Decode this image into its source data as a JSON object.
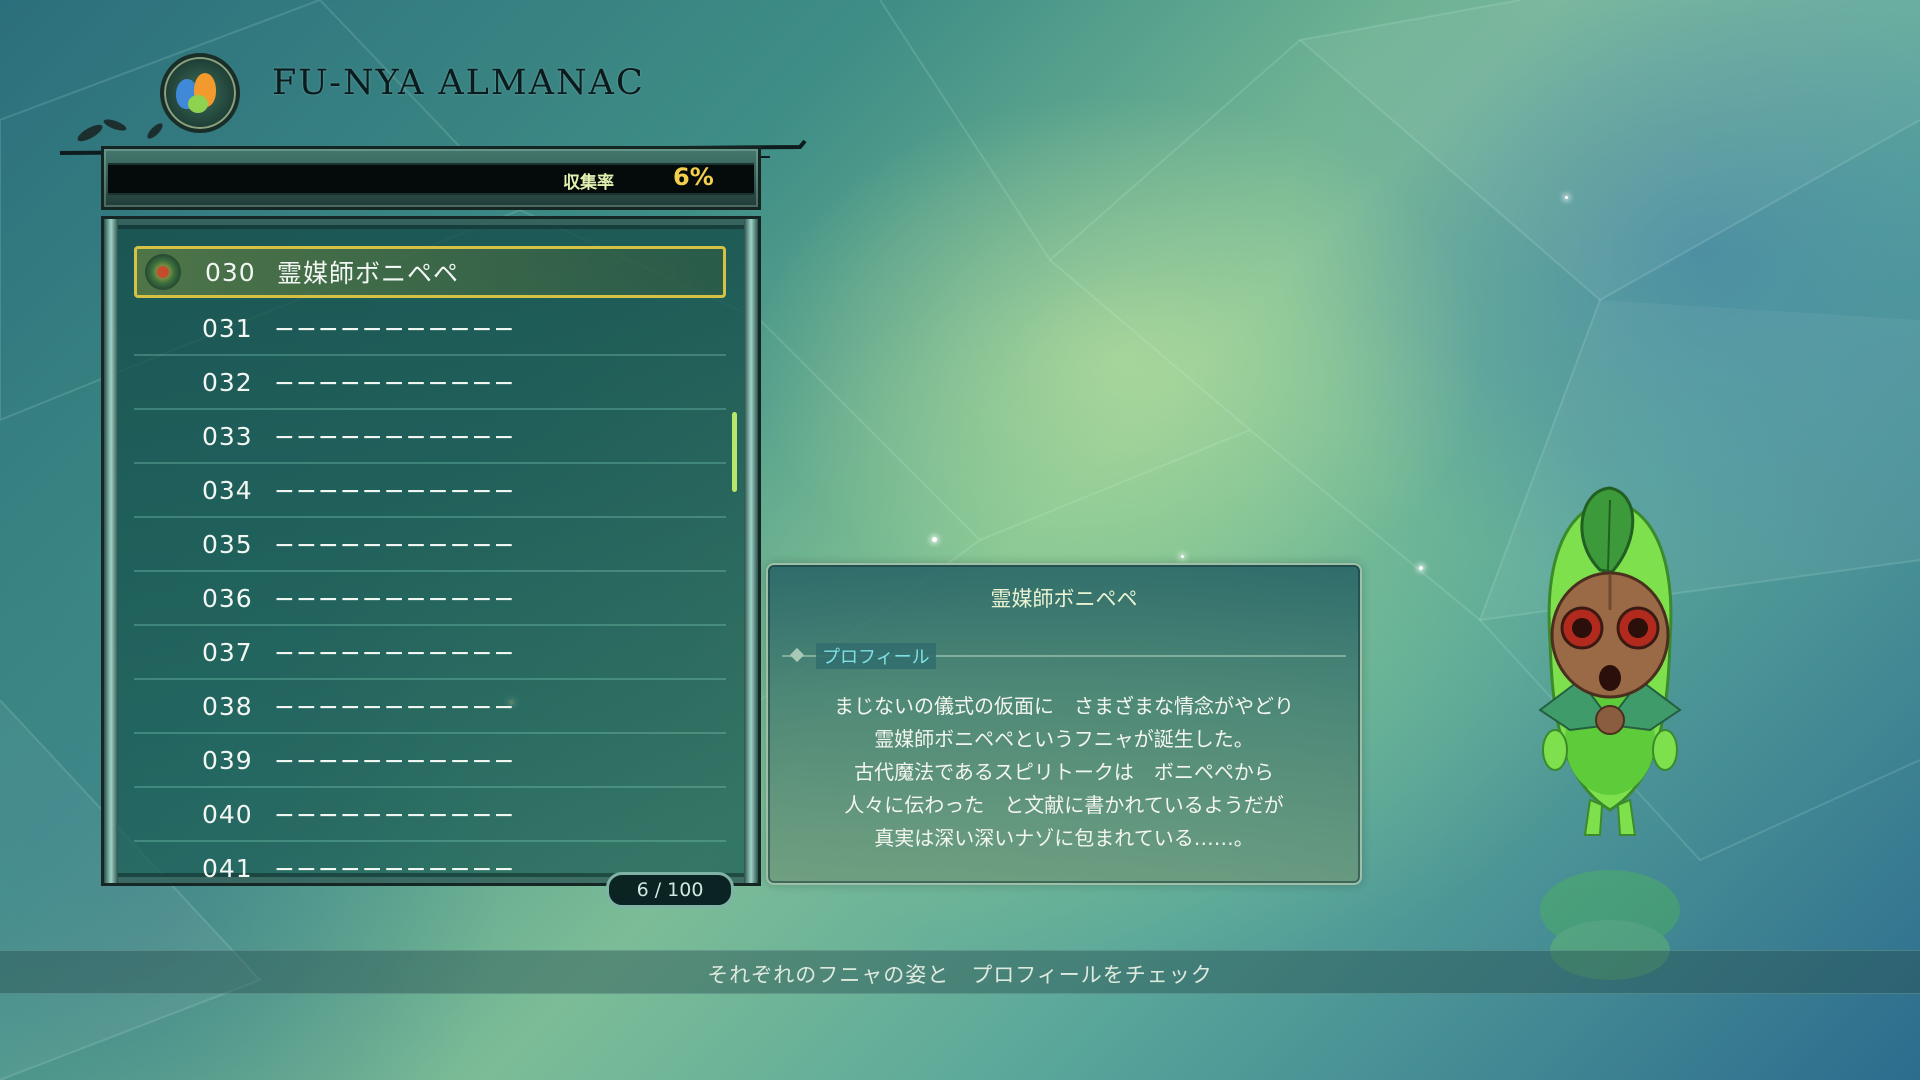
{
  "header": {
    "title": "FU-NYA  ALMANAC"
  },
  "collection_rate": {
    "label": "収集率",
    "value": "6%"
  },
  "almanac_list": {
    "items": [
      {
        "number": "030",
        "name": "霊媒師ボニペペ",
        "selected": true
      },
      {
        "number": "031",
        "name": "−−−−−−−−−−−"
      },
      {
        "number": "032",
        "name": "−−−−−−−−−−−"
      },
      {
        "number": "033",
        "name": "−−−−−−−−−−−"
      },
      {
        "number": "034",
        "name": "−−−−−−−−−−−"
      },
      {
        "number": "035",
        "name": "−−−−−−−−−−−"
      },
      {
        "number": "036",
        "name": "−−−−−−−−−−−"
      },
      {
        "number": "037",
        "name": "−−−−−−−−−−−"
      },
      {
        "number": "038",
        "name": "−−−−−−−−−−−"
      },
      {
        "number": "039",
        "name": "−−−−−−−−−−−"
      },
      {
        "number": "040",
        "name": "−−−−−−−−−−−"
      },
      {
        "number": "041",
        "name": "−−−−−−−−−−−"
      }
    ],
    "counter": "6  / 100"
  },
  "profile": {
    "name": "霊媒師ボニペペ",
    "section_label": "プロフィール",
    "lines": [
      "まじないの儀式の仮面に　さまざまな情念がやどり",
      "霊媒師ボニペペというフニャが誕生した。",
      "古代魔法であるスピリトークは　ボニペペから",
      "人々に伝わった　と文献に書かれているようだが",
      "真実は深い深いナゾに包まれている……。"
    ]
  },
  "footer": {
    "hint": "それぞれのフニャの姿と　プロフィールをチェック"
  },
  "colors": {
    "selection_border": "#d5c144",
    "rate_value": "#f2d04b",
    "section_label": "#7ee0e6"
  }
}
